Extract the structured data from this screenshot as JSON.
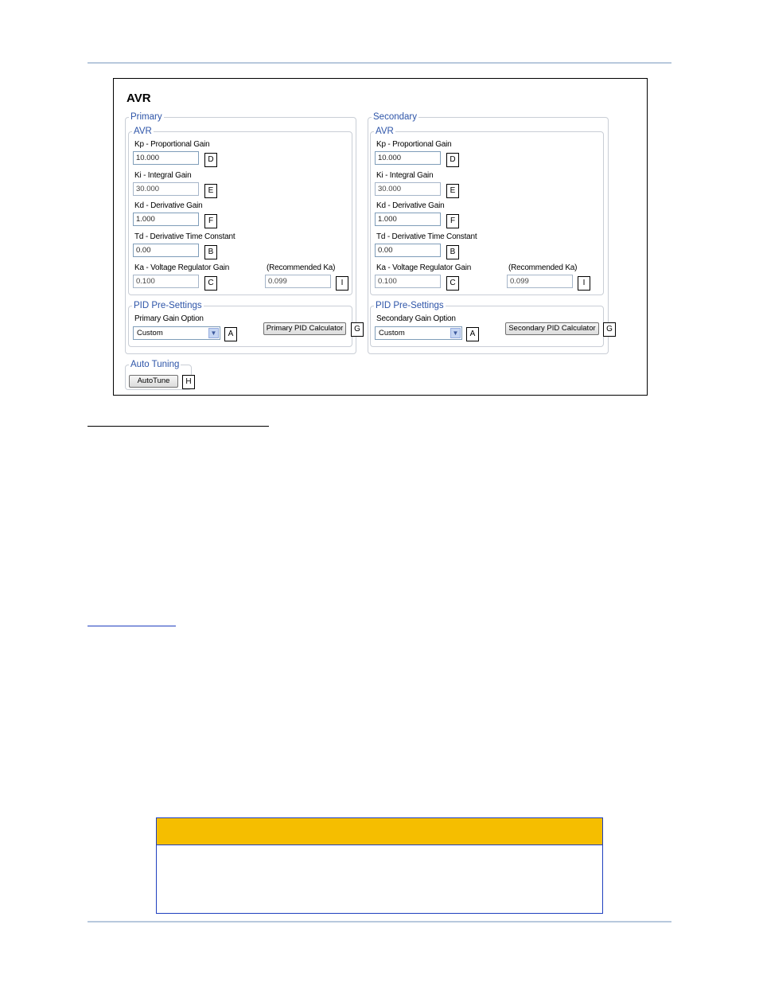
{
  "panel": {
    "title": "AVR",
    "primary": {
      "legend": "Primary",
      "avr_legend": "AVR",
      "kp": {
        "label": "Kp - Proportional Gain",
        "value": "10.000",
        "tag": "D"
      },
      "ki": {
        "label": "Ki - Integral Gain",
        "value": "30.000",
        "tag": "E"
      },
      "kd": {
        "label": "Kd - Derivative Gain",
        "value": "1.000",
        "tag": "F"
      },
      "td": {
        "label": "Td - Derivative Time Constant",
        "value": "0.00",
        "tag": "B"
      },
      "ka": {
        "label": "Ka - Voltage Regulator Gain",
        "value": "0.100",
        "tag": "C"
      },
      "rec": {
        "label": "(Recommended Ka)",
        "value": "0.099",
        "tag": "I"
      },
      "pid_legend": "PID Pre-Settings",
      "gain_option": {
        "label": "Primary Gain Option",
        "value": "Custom",
        "tag": "A"
      },
      "calc_button": {
        "label": "Primary PID Calculator",
        "tag": "G"
      }
    },
    "secondary": {
      "legend": "Secondary",
      "avr_legend": "AVR",
      "kp": {
        "label": "Kp - Proportional Gain",
        "value": "10.000",
        "tag": "D"
      },
      "ki": {
        "label": "Ki - Integral Gain",
        "value": "30.000",
        "tag": "E"
      },
      "kd": {
        "label": "Kd - Derivative Gain",
        "value": "1.000",
        "tag": "F"
      },
      "td": {
        "label": "Td - Derivative Time Constant",
        "value": "0.00",
        "tag": "B"
      },
      "ka": {
        "label": "Ka - Voltage Regulator Gain",
        "value": "0.100",
        "tag": "C"
      },
      "rec": {
        "label": "(Recommended Ka)",
        "value": "0.099",
        "tag": "I"
      },
      "pid_legend": "PID Pre-Settings",
      "gain_option": {
        "label": "Secondary Gain Option",
        "value": "Custom",
        "tag": "A"
      },
      "calc_button": {
        "label": "Secondary PID Calculator",
        "tag": "G"
      }
    },
    "auto_tuning": {
      "legend": "Auto Tuning",
      "button": "AutoTune",
      "tag": "H"
    }
  },
  "colors": {
    "legend_text": "#2d54a8",
    "rule": "#b8c9dd",
    "caution_header": "#f5be00",
    "caution_border": "#1f3fbf"
  }
}
